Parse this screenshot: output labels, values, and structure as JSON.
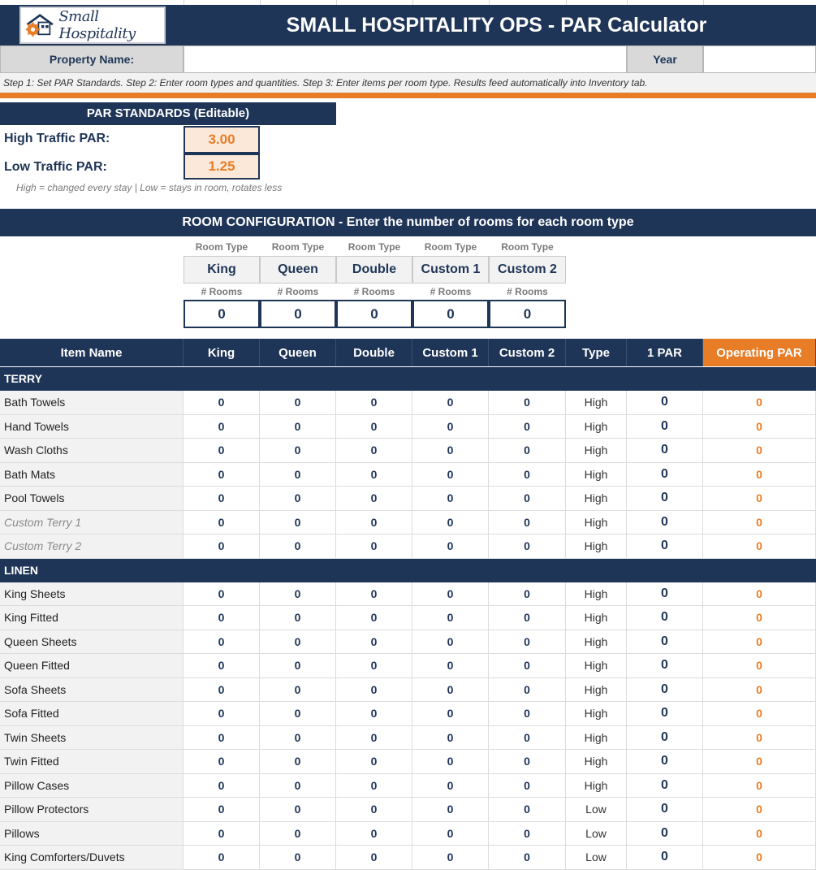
{
  "header": {
    "logo_text": "Small Hospitality",
    "title": "SMALL HOSPITALITY OPS - PAR Calculator"
  },
  "property": {
    "name_label": "Property Name:",
    "name_value": "",
    "year_label": "Year",
    "year_value": ""
  },
  "instructions": "Step 1: Set PAR Standards. Step 2: Enter room types and quantities. Step 3: Enter items per room type. Results feed automatically into Inventory tab.",
  "par_standards": {
    "title": "PAR STANDARDS (Editable)",
    "high_label": "High Traffic PAR:",
    "high_value": "3.00",
    "low_label": "Low Traffic PAR:",
    "low_value": "1.25",
    "note": "High = changed every stay | Low = stays in room, rotates less"
  },
  "room_config": {
    "title": "ROOM CONFIGURATION - Enter the number of rooms for each room type",
    "type_label": "Room Type",
    "rooms_label": "# Rooms",
    "room_types": [
      {
        "name": "King",
        "count": "0"
      },
      {
        "name": "Queen",
        "count": "0"
      },
      {
        "name": "Double",
        "count": "0"
      },
      {
        "name": "Custom 1",
        "count": "0"
      },
      {
        "name": "Custom 2",
        "count": "0"
      }
    ]
  },
  "columns": [
    "Item Name",
    "King",
    "Queen",
    "Double",
    "Custom 1",
    "Custom 2",
    "Type",
    "1 PAR",
    "Operating PAR"
  ],
  "colors": {
    "navy": "#1f3557",
    "orange": "#e87d27"
  },
  "sections": [
    {
      "title": "TERRY",
      "items": [
        {
          "name": "Bath Towels",
          "custom": false,
          "values": [
            "0",
            "0",
            "0",
            "0",
            "0"
          ],
          "type": "High",
          "par": "0",
          "op": "0"
        },
        {
          "name": "Hand Towels",
          "custom": false,
          "values": [
            "0",
            "0",
            "0",
            "0",
            "0"
          ],
          "type": "High",
          "par": "0",
          "op": "0"
        },
        {
          "name": "Wash Cloths",
          "custom": false,
          "values": [
            "0",
            "0",
            "0",
            "0",
            "0"
          ],
          "type": "High",
          "par": "0",
          "op": "0"
        },
        {
          "name": "Bath Mats",
          "custom": false,
          "values": [
            "0",
            "0",
            "0",
            "0",
            "0"
          ],
          "type": "High",
          "par": "0",
          "op": "0"
        },
        {
          "name": "Pool Towels",
          "custom": false,
          "values": [
            "0",
            "0",
            "0",
            "0",
            "0"
          ],
          "type": "High",
          "par": "0",
          "op": "0"
        },
        {
          "name": "Custom Terry 1",
          "custom": true,
          "values": [
            "0",
            "0",
            "0",
            "0",
            "0"
          ],
          "type": "High",
          "par": "0",
          "op": "0"
        },
        {
          "name": "Custom Terry 2",
          "custom": true,
          "values": [
            "0",
            "0",
            "0",
            "0",
            "0"
          ],
          "type": "High",
          "par": "0",
          "op": "0"
        }
      ]
    },
    {
      "title": "LINEN",
      "items": [
        {
          "name": "King Sheets",
          "custom": false,
          "values": [
            "0",
            "0",
            "0",
            "0",
            "0"
          ],
          "type": "High",
          "par": "0",
          "op": "0"
        },
        {
          "name": "King Fitted",
          "custom": false,
          "values": [
            "0",
            "0",
            "0",
            "0",
            "0"
          ],
          "type": "High",
          "par": "0",
          "op": "0"
        },
        {
          "name": "Queen Sheets",
          "custom": false,
          "values": [
            "0",
            "0",
            "0",
            "0",
            "0"
          ],
          "type": "High",
          "par": "0",
          "op": "0"
        },
        {
          "name": "Queen Fitted",
          "custom": false,
          "values": [
            "0",
            "0",
            "0",
            "0",
            "0"
          ],
          "type": "High",
          "par": "0",
          "op": "0"
        },
        {
          "name": "Sofa Sheets",
          "custom": false,
          "values": [
            "0",
            "0",
            "0",
            "0",
            "0"
          ],
          "type": "High",
          "par": "0",
          "op": "0"
        },
        {
          "name": "Sofa Fitted",
          "custom": false,
          "values": [
            "0",
            "0",
            "0",
            "0",
            "0"
          ],
          "type": "High",
          "par": "0",
          "op": "0"
        },
        {
          "name": "Twin Sheets",
          "custom": false,
          "values": [
            "0",
            "0",
            "0",
            "0",
            "0"
          ],
          "type": "High",
          "par": "0",
          "op": "0"
        },
        {
          "name": "Twin Fitted",
          "custom": false,
          "values": [
            "0",
            "0",
            "0",
            "0",
            "0"
          ],
          "type": "High",
          "par": "0",
          "op": "0"
        },
        {
          "name": "Pillow Cases",
          "custom": false,
          "values": [
            "0",
            "0",
            "0",
            "0",
            "0"
          ],
          "type": "High",
          "par": "0",
          "op": "0"
        },
        {
          "name": "Pillow Protectors",
          "custom": false,
          "values": [
            "0",
            "0",
            "0",
            "0",
            "0"
          ],
          "type": "Low",
          "par": "0",
          "op": "0"
        },
        {
          "name": "Pillows",
          "custom": false,
          "values": [
            "0",
            "0",
            "0",
            "0",
            "0"
          ],
          "type": "Low",
          "par": "0",
          "op": "0"
        },
        {
          "name": "King Comforters/Duvets",
          "custom": false,
          "values": [
            "0",
            "0",
            "0",
            "0",
            "0"
          ],
          "type": "Low",
          "par": "0",
          "op": "0"
        }
      ]
    }
  ]
}
